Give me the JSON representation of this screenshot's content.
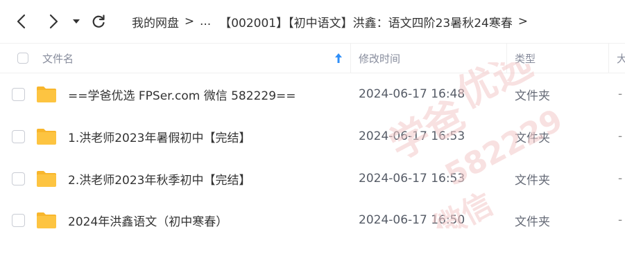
{
  "toolbar": {
    "back_icon": "chevron-left-icon",
    "forward_icon": "chevron-right-icon",
    "history_icon": "caret-down-icon",
    "refresh_icon": "refresh-icon"
  },
  "breadcrumb": {
    "root": "我的网盘",
    "ellipsis": "...",
    "current": "【002001】【初中语文】洪鑫：语文四阶23暑秋24寒春",
    "separator": ">"
  },
  "table": {
    "columns": {
      "name": "文件名",
      "modified": "修改时间",
      "type": "类型",
      "size": "大"
    },
    "rows": [
      {
        "name": "==学爸优选 FPSer.com 微信 582229==",
        "modified": "2024-06-17 16:48",
        "type": "文件夹",
        "size": "-"
      },
      {
        "name": "1.洪老师2023年暑假初中【完结】",
        "modified": "2024-06-17 16:53",
        "type": "文件夹",
        "size": "-"
      },
      {
        "name": "2.洪老师2023年秋季初中【完结】",
        "modified": "2024-06-17 16:53",
        "type": "文件夹",
        "size": "-"
      },
      {
        "name": "2024年洪鑫语文（初中寒春）",
        "modified": "2024-06-17 16:50",
        "type": "文件夹",
        "size": "-"
      }
    ]
  },
  "watermark": {
    "lines": [
      "学爸",
      "优选",
      "582229",
      "微信"
    ]
  },
  "colors": {
    "accent": "#2f8ff8",
    "folder": "#fdc441",
    "folder_tab": "#f8b62c",
    "watermark": "#f3c9c9"
  }
}
